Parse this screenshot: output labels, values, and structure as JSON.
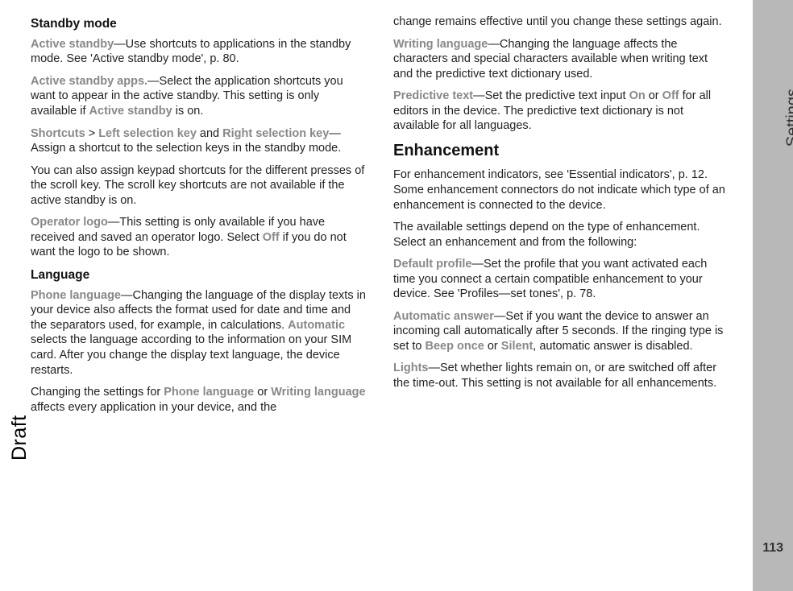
{
  "left": {
    "h_standby": "Standby mode",
    "p1a": "Active standby",
    "p1b": "—Use shortcuts to applications in the standby mode. See 'Active standby mode', p. 80.",
    "p2a": "Active standby apps.",
    "p2b": "—Select the application shortcuts you want to appear in the active standby. This setting is only available if ",
    "p2c": "Active standby",
    "p2d": " is on.",
    "p3a": "Shortcuts",
    "p3b": " > ",
    "p3c": "Left selection key",
    "p3d": " and ",
    "p3e": "Right selection key",
    "p3f": "—Assign a shortcut to the selection keys in the standby mode.",
    "p4": "You can also assign keypad shortcuts for the different presses of the scroll key. The scroll key shortcuts are not available if the active standby is on.",
    "p5a": "Operator logo",
    "p5b": "—This setting is only available if you have received and saved an operator logo. Select ",
    "p5c": "Off",
    "p5d": " if you do not want the logo to be shown.",
    "h_language": "Language",
    "p6a": "Phone language",
    "p6b": "—Changing the language of the display texts in your device also affects the format used for date and time and the separators used, for example, in calculations. ",
    "p6c": "Automatic",
    "p6d": " selects the language according to the information on your SIM card. After you change the display text language, the device restarts.",
    "p7a": "Changing the settings for ",
    "p7b": "Phone language",
    "p7c": " or ",
    "p7d": "Writing language",
    "p7e": " affects every application in your device, and the"
  },
  "right": {
    "r1": "change remains effective until you change these settings again.",
    "r2a": "Writing language",
    "r2b": "—Changing the language affects the characters and special characters available when writing text and the predictive text dictionary used.",
    "r3a": "Predictive text",
    "r3b": "—Set the predictive text input ",
    "r3c": "On",
    "r3d": " or ",
    "r3e": "Off",
    "r3f": " for all editors in the device. The predictive text dictionary is not available for all languages.",
    "h_enh": "Enhancement",
    "r4": "For enhancement indicators, see 'Essential indicators', p. 12. Some enhancement connectors do not indicate which type of an enhancement is connected to the device.",
    "r5": "The available settings depend on the type of enhancement. Select an enhancement and from the following:",
    "r6a": "Default profile",
    "r6b": "—Set the profile that you want activated each time you connect a certain compatible enhancement to your device. See 'Profiles—set tones', p. 78.",
    "r7a": "Automatic answer",
    "r7b": "—Set if you want the device to answer an incoming call automatically after 5 seconds. If the ringing type is set to ",
    "r7c": "Beep once",
    "r7d": " or ",
    "r7e": "Silent",
    "r7f": ", automatic answer is disabled.",
    "r8a": "Lights",
    "r8b": "—Set whether lights remain on, or are switched off after the time-out. This setting is not available for all enhancements."
  },
  "labels": {
    "draft": "Draft",
    "section": "Settings",
    "page": "113"
  }
}
